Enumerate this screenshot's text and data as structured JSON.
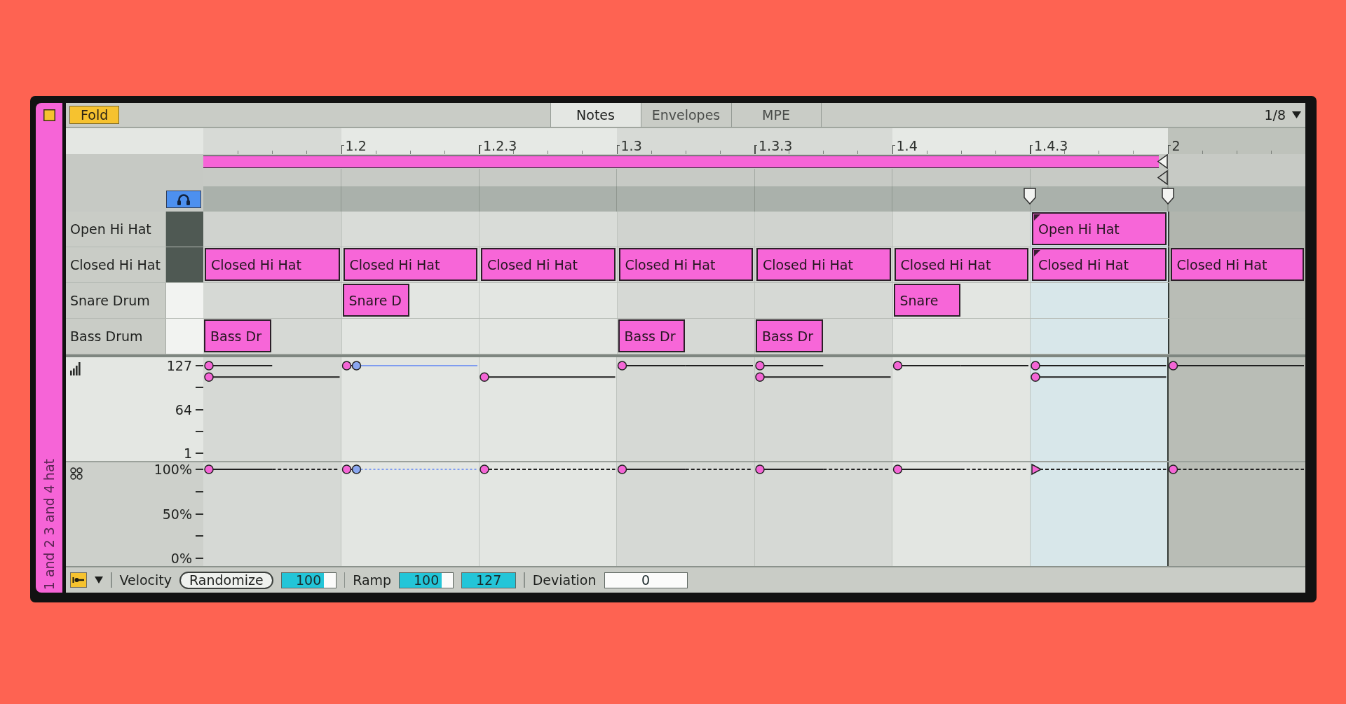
{
  "clip": {
    "name": "1 and 2 3 and 4 hat"
  },
  "header": {
    "fold": {
      "label": "Fold",
      "on": true
    },
    "tabs": [
      {
        "label": "Notes",
        "selected": true
      },
      {
        "label": "Envelopes",
        "selected": false
      },
      {
        "label": "MPE",
        "selected": false
      }
    ],
    "grid": {
      "value": "1/8"
    }
  },
  "timeline": {
    "steps": [
      {
        "looped": true,
        "selected": false
      },
      {
        "label": "1.2",
        "looped": true,
        "selected": false
      },
      {
        "label": "1.2.3",
        "looped": true,
        "selected": false
      },
      {
        "label": "1.3",
        "looped": true,
        "selected": false
      },
      {
        "label": "1.3.3",
        "looped": true,
        "selected": false
      },
      {
        "label": "1.4",
        "looped": true,
        "selected": false
      },
      {
        "label": "1.4.3",
        "looped": true,
        "selected": true
      },
      {
        "label": "2",
        "looped": false,
        "selected": false
      }
    ]
  },
  "preview": {
    "on": true
  },
  "rows": [
    {
      "name": "Open Hi Hat",
      "black_key": true,
      "steps": [
        {
          "has_note": false
        },
        {
          "has_note": false
        },
        {
          "has_note": false
        },
        {
          "has_note": false
        },
        {
          "has_note": false
        },
        {
          "has_note": false
        },
        {
          "has_note": true,
          "label": "Open Hi Hat",
          "kind": "eighth",
          "selected": false,
          "grouped": true,
          "velocity": {
            "level": 1
          },
          "chance": {
            "level": 1
          }
        },
        {
          "has_note": false
        }
      ]
    },
    {
      "name": "Closed Hi Hat",
      "black_key": true,
      "steps": [
        {
          "has_note": true,
          "label": "Closed Hi Hat",
          "kind": "eighth",
          "selected": false,
          "grouped": false,
          "velocity": {
            "level": 0.87
          },
          "chance": {
            "level": 1
          }
        },
        {
          "has_note": true,
          "label": "Closed Hi Hat",
          "kind": "eighth",
          "selected": true,
          "grouped": false,
          "velocity": {
            "level": 1
          },
          "chance": {
            "level": 1
          }
        },
        {
          "has_note": true,
          "label": "Closed Hi Hat",
          "kind": "eighth",
          "selected": false,
          "grouped": false,
          "velocity": {
            "level": 0.87
          },
          "chance": {
            "level": 1
          }
        },
        {
          "has_note": true,
          "label": "Closed Hi Hat",
          "kind": "eighth",
          "selected": false,
          "grouped": false,
          "velocity": {
            "level": 1
          },
          "chance": {
            "level": 1
          }
        },
        {
          "has_note": true,
          "label": "Closed Hi Hat",
          "kind": "eighth",
          "selected": false,
          "grouped": false,
          "velocity": {
            "level": 0.87
          },
          "chance": {
            "level": 1
          }
        },
        {
          "has_note": true,
          "label": "Closed Hi Hat",
          "kind": "eighth",
          "selected": false,
          "grouped": false,
          "velocity": {
            "level": 1
          },
          "chance": {
            "level": 1
          }
        },
        {
          "has_note": true,
          "label": "Closed Hi Hat",
          "kind": "eighth",
          "selected": false,
          "grouped": true,
          "velocity": {
            "level": 0.87
          },
          "chance": {
            "level": 1
          }
        },
        {
          "has_note": true,
          "label": "Closed Hi Hat",
          "kind": "eighth",
          "selected": false,
          "grouped": false,
          "velocity": {
            "level": 1
          },
          "chance": {
            "level": 1
          }
        }
      ]
    },
    {
      "name": "Snare Drum",
      "black_key": false,
      "steps": [
        {
          "has_note": false
        },
        {
          "has_note": true,
          "label": "Snare D",
          "kind": "sixteenth",
          "selected": false,
          "grouped": false,
          "velocity": {
            "level": 1
          },
          "chance": {
            "level": 1
          }
        },
        {
          "has_note": false
        },
        {
          "has_note": false
        },
        {
          "has_note": false
        },
        {
          "has_note": true,
          "label": "Snare",
          "kind": "sixteenth",
          "selected": false,
          "grouped": false,
          "velocity": {
            "level": 1
          },
          "chance": {
            "level": 1
          }
        },
        {
          "has_note": false
        },
        {
          "has_note": false
        }
      ]
    },
    {
      "name": "Bass Drum",
      "black_key": false,
      "steps": [
        {
          "has_note": true,
          "label": "Bass Dr",
          "kind": "sixteenth",
          "selected": false,
          "grouped": false,
          "velocity": {
            "level": 1
          },
          "chance": {
            "level": 1
          }
        },
        {
          "has_note": false
        },
        {
          "has_note": false
        },
        {
          "has_note": true,
          "label": "Bass Dr",
          "kind": "sixteenth",
          "selected": false,
          "grouped": false,
          "velocity": {
            "level": 1
          },
          "chance": {
            "level": 1
          }
        },
        {
          "has_note": true,
          "label": "Bass Dr",
          "kind": "sixteenth",
          "selected": false,
          "grouped": false,
          "velocity": {
            "level": 1
          },
          "chance": {
            "level": 1
          }
        },
        {
          "has_note": false
        },
        {
          "has_note": false
        },
        {
          "has_note": false
        }
      ]
    }
  ],
  "velocity_lane": {
    "scale": [
      "127",
      "64",
      "1"
    ]
  },
  "chance_lane": {
    "scale": [
      "100%",
      "50%",
      "0%"
    ]
  },
  "bottom_bar": {
    "mode": {
      "on": true
    },
    "velocity": {
      "label": "Velocity",
      "randomize": "Randomize",
      "value": {
        "text": "100",
        "level": 0.79
      }
    },
    "ramp": {
      "label": "Ramp",
      "start": {
        "text": "100",
        "level": 0.79
      },
      "end": {
        "text": "127",
        "level": 1
      }
    },
    "deviation": {
      "label": "Deviation",
      "value": "0"
    }
  }
}
